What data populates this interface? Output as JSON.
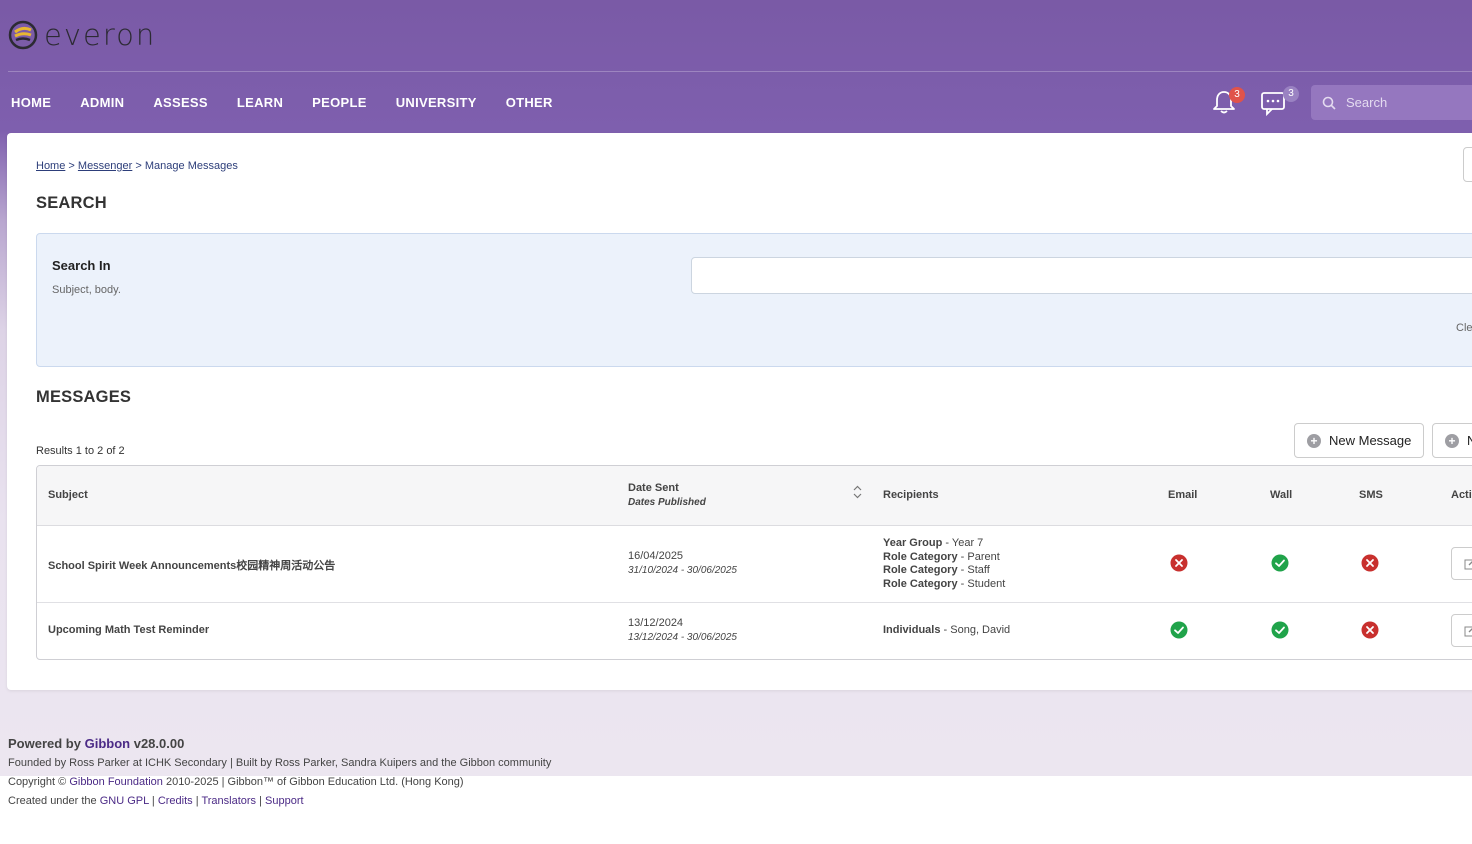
{
  "brand": {
    "logo_text": "everon"
  },
  "nav": {
    "items": [
      "HOME",
      "ADMIN",
      "ASSESS",
      "LEARN",
      "PEOPLE",
      "UNIVERSITY",
      "OTHER"
    ]
  },
  "header": {
    "notifications_count": "3",
    "messages_count": "3",
    "search_placeholder": "Search"
  },
  "breadcrumb": {
    "items": [
      "Home",
      "Messenger",
      "Manage Messages"
    ],
    "separator": ">"
  },
  "search_section": {
    "title": "SEARCH",
    "label": "Search In",
    "description": "Subject, body.",
    "value": "",
    "clear_label": "Cle"
  },
  "messages_section": {
    "title": "MESSAGES",
    "results_text": "Results 1 to 2 of 2",
    "new_message_label": "New Message",
    "second_button_label": "N"
  },
  "table": {
    "headers": {
      "subject": "Subject",
      "date_sent": "Date Sent",
      "dates_published": "Dates Published",
      "recipients": "Recipients",
      "email": "Email",
      "wall": "Wall",
      "sms": "SMS",
      "actions": "Acti"
    },
    "rows": [
      {
        "subject": "School Spirit Week Announcements校园精神周活动公告",
        "date_sent": "16/04/2025",
        "dates_published": "31/10/2024 - 30/06/2025",
        "recipients": [
          {
            "type": "Year Group",
            "value": "Year 7"
          },
          {
            "type": "Role Category",
            "value": "Parent"
          },
          {
            "type": "Role Category",
            "value": "Staff"
          },
          {
            "type": "Role Category",
            "value": "Student"
          }
        ],
        "email": false,
        "wall": true,
        "sms": false
      },
      {
        "subject": "Upcoming Math Test Reminder",
        "date_sent": "13/12/2024",
        "dates_published": "13/12/2024 - 30/06/2025",
        "recipients": [
          {
            "type": "Individuals",
            "value": "Song, David"
          }
        ],
        "email": true,
        "wall": true,
        "sms": false
      }
    ]
  },
  "footer": {
    "powered_prefix": "Powered by",
    "powered_link": "Gibbon",
    "version": "v28.0.00",
    "founded": "Founded by Ross Parker at ICHK Secondary | Built by Ross Parker, Sandra Kuipers and the Gibbon community",
    "copyright_prefix": "Copyright ©",
    "copyright_link": "Gibbon Foundation",
    "copyright_suffix": "2010-2025 | Gibbon™ of Gibbon Education Ltd. (Hong Kong)",
    "created_prefix": "Created under the",
    "links": [
      "GNU GPL",
      "Credits",
      "Translators",
      "Support"
    ]
  },
  "colors": {
    "brand_purple": "#7e5fae",
    "link_blue": "#2d3e7a",
    "success_green": "#20a34a",
    "error_red": "#c8302e"
  }
}
